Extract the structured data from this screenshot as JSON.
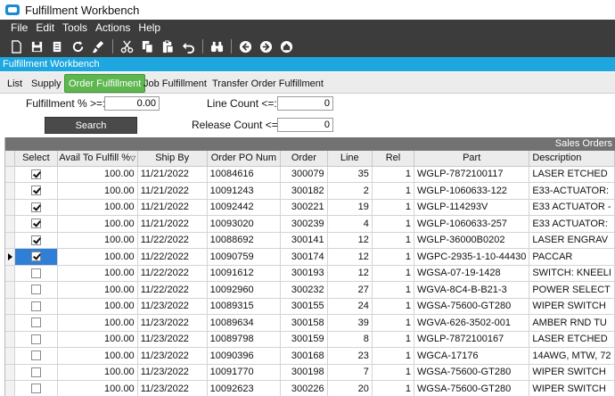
{
  "window": {
    "title": "Fulfillment Workbench"
  },
  "menu": [
    "File",
    "Edit",
    "Tools",
    "Actions",
    "Help"
  ],
  "toolbar": {
    "icons": [
      "new-icon",
      "save-icon",
      "delete-icon",
      "refresh-icon",
      "clear-icon",
      "cut-icon",
      "copy-icon",
      "paste-icon",
      "undo-icon",
      "search-binoculars-icon",
      "back-icon",
      "forward-icon",
      "home-icon"
    ]
  },
  "app_band": {
    "label": "Fulfillment Workbench"
  },
  "tabs": [
    {
      "label": "List",
      "active": false
    },
    {
      "label": "Supply",
      "active": false
    },
    {
      "label": "Order Fulfillment",
      "active": true
    },
    {
      "label": "Job Fulfillment",
      "active": false
    },
    {
      "label": "Transfer Order Fulfillment",
      "active": false
    }
  ],
  "filters": {
    "fulfillment_label": "Fulfillment % >=:",
    "fulfillment_value": "0.00",
    "line_count_label": "Line Count <=:",
    "line_count_value": "0",
    "release_count_label": "Release Count <=:",
    "release_count_value": "0",
    "search_label": "Search"
  },
  "grid": {
    "caption": "Sales Orders",
    "columns": [
      "Select",
      "Avail To Fulfill %",
      "Ship By",
      "Order PO Num",
      "Order",
      "Line",
      "Rel",
      "Part",
      "Description"
    ],
    "sort_mark": "▽",
    "rows": [
      {
        "select": true,
        "avail": "100.00",
        "ship_by": "11/21/2022",
        "po_num": "10084616",
        "order": "300079",
        "line": "35",
        "rel": "1",
        "part": "WGLP-7872100117",
        "desc": "LASER ETCHED"
      },
      {
        "select": true,
        "avail": "100.00",
        "ship_by": "11/21/2022",
        "po_num": "10091243",
        "order": "300182",
        "line": "2",
        "rel": "1",
        "part": "WGLP-1060633-122",
        "desc": "E33-ACTUATOR:"
      },
      {
        "select": true,
        "avail": "100.00",
        "ship_by": "11/21/2022",
        "po_num": "10092442",
        "order": "300221",
        "line": "19",
        "rel": "1",
        "part": "WGLP-114293V",
        "desc": "E33 ACTUATOR -"
      },
      {
        "select": true,
        "avail": "100.00",
        "ship_by": "11/21/2022",
        "po_num": "10093020",
        "order": "300239",
        "line": "4",
        "rel": "1",
        "part": "WGLP-1060633-257",
        "desc": "E33 ACTUATOR:"
      },
      {
        "select": true,
        "avail": "100.00",
        "ship_by": "11/22/2022",
        "po_num": "10088692",
        "order": "300141",
        "line": "12",
        "rel": "1",
        "part": "WGLP-36000B0202",
        "desc": "LASER ENGRAV"
      },
      {
        "select": true,
        "avail": "100.00",
        "ship_by": "11/22/2022",
        "po_num": "10090759",
        "order": "300174",
        "line": "12",
        "rel": "1",
        "part": "WGPC-2935-1-10-44430",
        "desc": "PACCAR",
        "current": true
      },
      {
        "select": false,
        "avail": "100.00",
        "ship_by": "11/22/2022",
        "po_num": "10091612",
        "order": "300193",
        "line": "12",
        "rel": "1",
        "part": "WGSA-07-19-1428",
        "desc": "SWITCH: KNEELI"
      },
      {
        "select": false,
        "avail": "100.00",
        "ship_by": "11/22/2022",
        "po_num": "10092960",
        "order": "300232",
        "line": "27",
        "rel": "1",
        "part": "WGVA-8C4-B-B21-3",
        "desc": "POWER SELECT"
      },
      {
        "select": false,
        "avail": "100.00",
        "ship_by": "11/23/2022",
        "po_num": "10089315",
        "order": "300155",
        "line": "24",
        "rel": "1",
        "part": "WGSA-75600-GT280",
        "desc": "WIPER SWITCH"
      },
      {
        "select": false,
        "avail": "100.00",
        "ship_by": "11/23/2022",
        "po_num": "10089634",
        "order": "300158",
        "line": "39",
        "rel": "1",
        "part": "WGVA-626-3502-001",
        "desc": "AMBER RND TU"
      },
      {
        "select": false,
        "avail": "100.00",
        "ship_by": "11/23/2022",
        "po_num": "10089798",
        "order": "300159",
        "line": "8",
        "rel": "1",
        "part": "WGLP-7872100167",
        "desc": "LASER ETCHED"
      },
      {
        "select": false,
        "avail": "100.00",
        "ship_by": "11/23/2022",
        "po_num": "10090396",
        "order": "300168",
        "line": "23",
        "rel": "1",
        "part": "WGCA-17176",
        "desc": "14AWG, MTW, 72"
      },
      {
        "select": false,
        "avail": "100.00",
        "ship_by": "11/23/2022",
        "po_num": "10091770",
        "order": "300198",
        "line": "7",
        "rel": "1",
        "part": "WGSA-75600-GT280",
        "desc": "WIPER SWITCH"
      },
      {
        "select": false,
        "avail": "100.00",
        "ship_by": "11/23/2022",
        "po_num": "10092623",
        "order": "300226",
        "line": "20",
        "rel": "1",
        "part": "WGSA-75600-GT280",
        "desc": "WIPER SWITCH"
      }
    ]
  }
}
